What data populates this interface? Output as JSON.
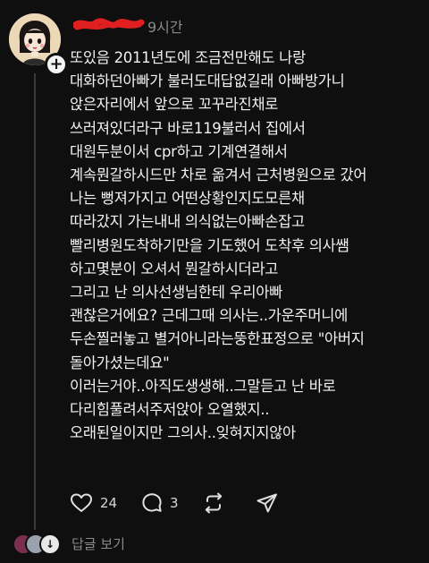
{
  "post": {
    "author": {
      "avatar_icon": "cartoon-girl-avatar",
      "username_redacted": true,
      "timestamp": "9시간"
    },
    "lines": [
      "또있음 2011년도에 조금전만해도 나랑",
      "대화하던아빠가 불러도대답없길래 아빠방가니",
      "앉은자리에서 앞으로 꼬꾸라진채로",
      "쓰러져있더라구 바로119불러서 집에서",
      "대원두분이서 cpr하고 기계연결해서",
      "계속뭔갈하시드만 차로 옮겨서 근처병원으로 갔어",
      "나는 뻥져가지고 어떤상황인지도모른채",
      "따라갔지 가는내내 의식없는아빠손잡고",
      "빨리병원도착하기만을 기도했어 도착후 의사쌤",
      "하고몇분이 오셔서 뭔갈하시더라고",
      "그리고 난 의사선생님한테 우리아빠",
      "괜찮은거에요? 근데그때 의사는..가운주머니에",
      "두손찔러놓고 별거아니라는뚱한표정으로 \"아버지",
      "돌아가셨는데요\"",
      "이러는거야..아직도생생해..그말듣고 난 바로",
      "다리힘풀려서주저앉아 오열했지..",
      "오래된일이지만 그의사..잊혀지지않아"
    ],
    "actions": {
      "like_icon": "heart-icon",
      "like_count": "24",
      "reply_icon": "comment-icon",
      "reply_count": "3",
      "repost_icon": "repost-icon",
      "share_icon": "send-icon"
    },
    "replies": {
      "label": "답글 보기"
    }
  }
}
